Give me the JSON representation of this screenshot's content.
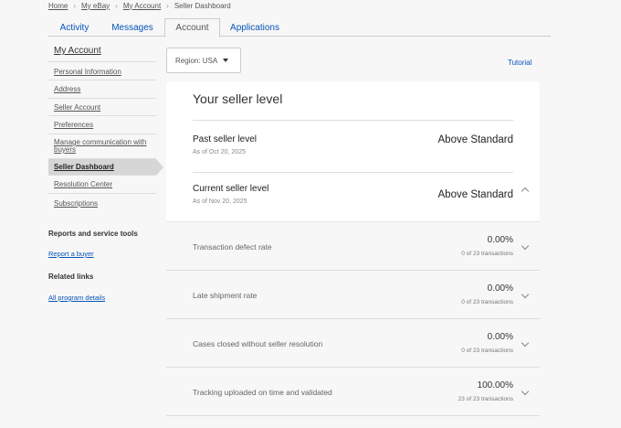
{
  "breadcrumb": [
    "Home",
    "My eBay",
    "My Account",
    "Seller Dashboard"
  ],
  "tabs": [
    "Activity",
    "Messages",
    "Account",
    "Applications"
  ],
  "sidebar": {
    "heading": "My Account",
    "items": [
      "Personal Information",
      "Address",
      "Seller Account",
      "Preferences",
      "Manage communication with buyers",
      "Seller Dashboard",
      "Resolution Center",
      "Subscriptions"
    ],
    "reports_title": "Reports and service tools",
    "report_link": "Report a buyer",
    "related_title": "Related links",
    "related_link": "All program details"
  },
  "region": "Region: USA",
  "tutorial": "Tutorial",
  "panel": {
    "title": "Your seller level",
    "past": {
      "label": "Past seller level",
      "date": "As of Oct 20, 2025",
      "value": "Above Standard"
    },
    "current": {
      "label": "Current seller level",
      "date": "As of Nov 20, 2025",
      "value": "Above Standard"
    }
  },
  "metrics": [
    {
      "label": "Transaction defect rate",
      "value": "0.00%",
      "sub": "0 of 23 transactions"
    },
    {
      "label": "Late shipment rate",
      "value": "0.00%",
      "sub": "0 of 23 transactions"
    },
    {
      "label": "Cases closed without seller resolution",
      "value": "0.00%",
      "sub": "0 of 23 transactions"
    },
    {
      "label": "Tracking uploaded on time and validated",
      "value": "100.00%",
      "sub": "23 of 23 transactions"
    }
  ]
}
